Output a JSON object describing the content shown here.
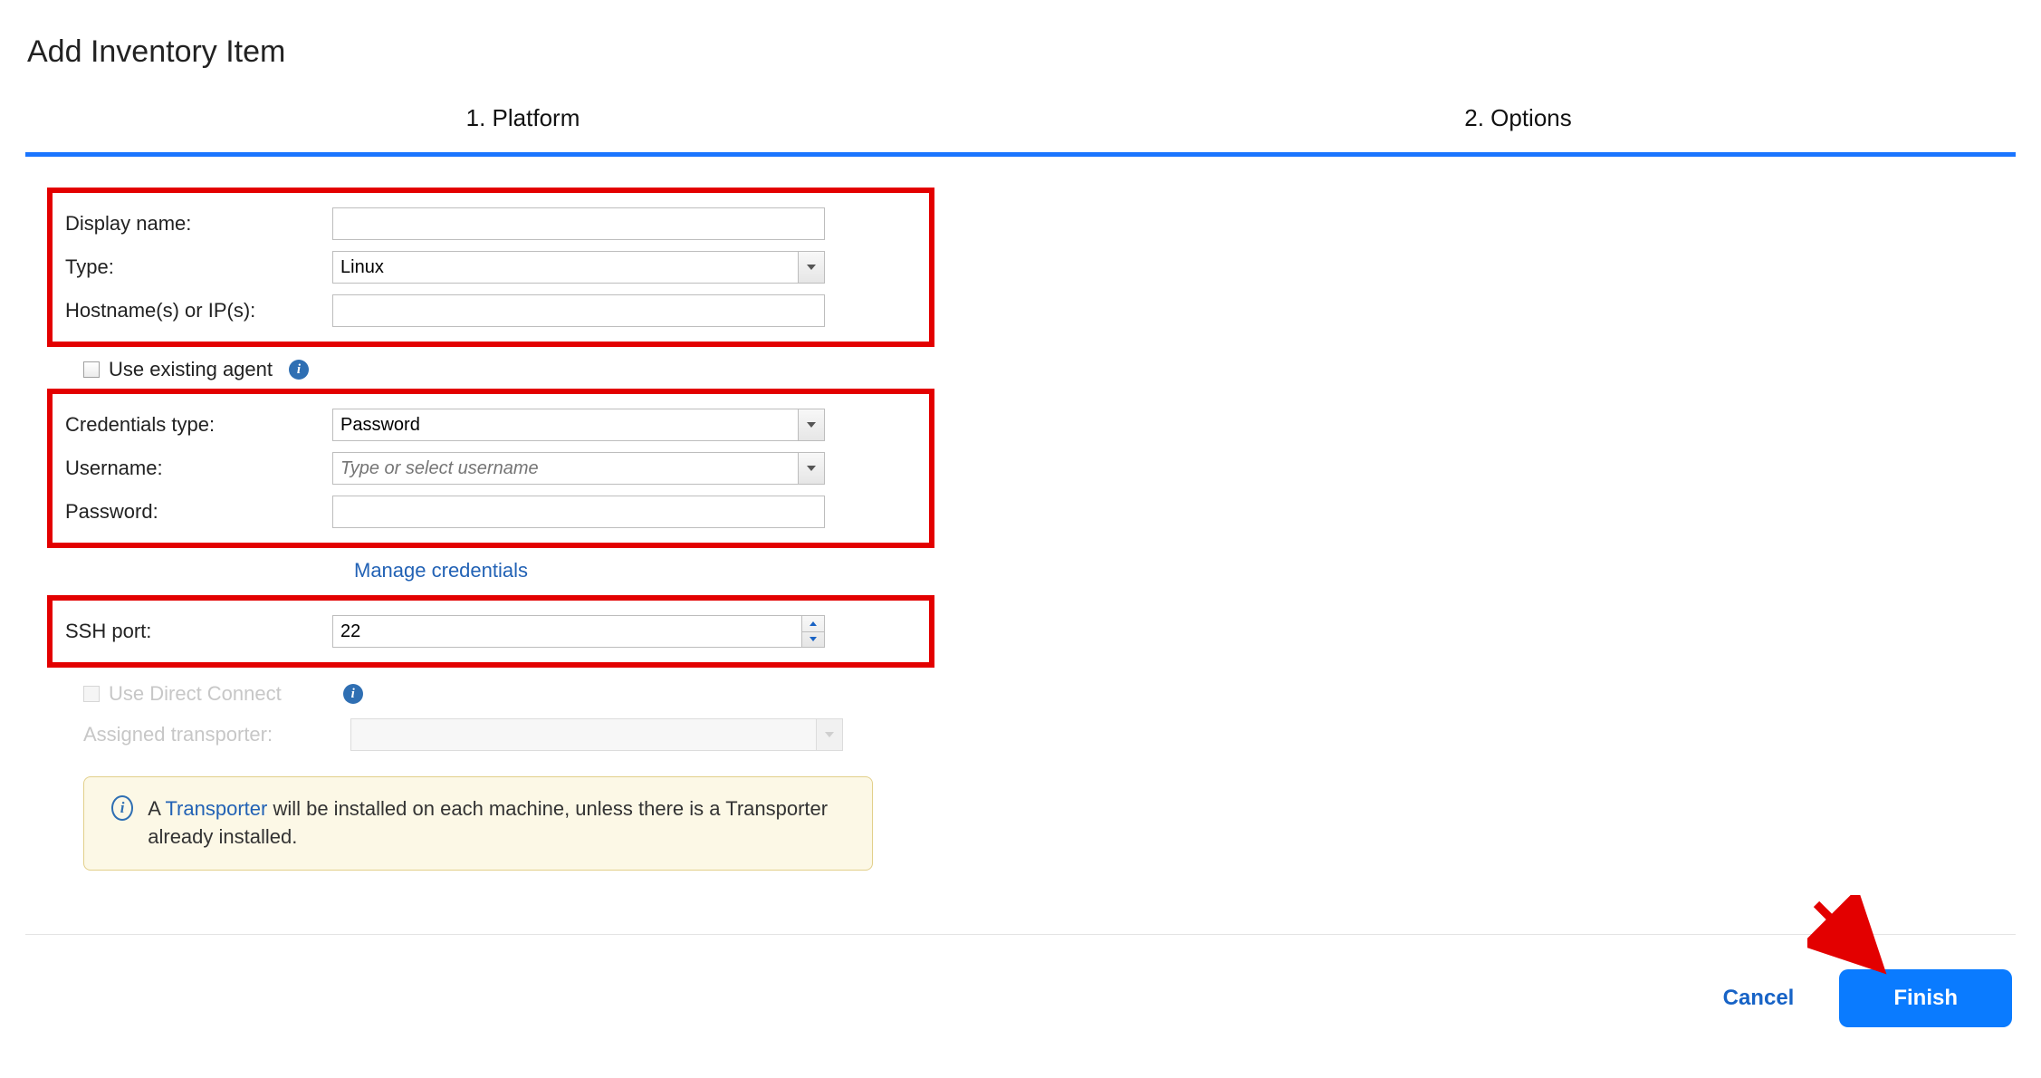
{
  "title": "Add Inventory Item",
  "steps": {
    "step1": "1. Platform",
    "step2": "2. Options"
  },
  "form": {
    "display_name": {
      "label": "Display name:",
      "value": ""
    },
    "type": {
      "label": "Type:",
      "value": "Linux"
    },
    "hostnames": {
      "label": "Hostname(s) or IP(s):",
      "value": ""
    },
    "use_existing_agent": {
      "label": "Use existing agent"
    },
    "credentials_type": {
      "label": "Credentials type:",
      "value": "Password"
    },
    "username": {
      "label": "Username:",
      "value": "",
      "placeholder": "Type or select username"
    },
    "password": {
      "label": "Password:",
      "value": ""
    },
    "manage_credentials": "Manage credentials",
    "ssh_port": {
      "label": "SSH port:",
      "value": "22"
    },
    "use_direct_connect": {
      "label": "Use Direct Connect"
    },
    "assigned_transporter": {
      "label": "Assigned transporter:",
      "value": ""
    }
  },
  "info_panel": {
    "prefix": "A ",
    "link": "Transporter",
    "suffix": " will be installed on each machine, unless there is a Transporter already installed."
  },
  "footer": {
    "cancel": "Cancel",
    "finish": "Finish"
  }
}
